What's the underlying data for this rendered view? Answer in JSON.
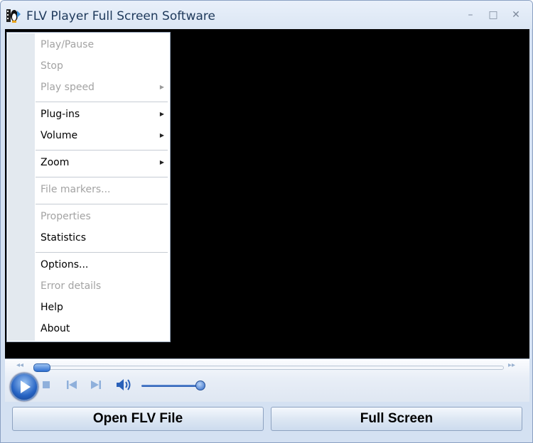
{
  "window": {
    "title": "FLV Player Full Screen Software"
  },
  "colors": {
    "title_text": "#1e395b",
    "video_bg": "#000000",
    "disabled_text": "#a3a3a3",
    "accent": "#2663c3"
  },
  "icons": {
    "app": "film-tux-icon",
    "minimize": "minimize-icon",
    "maximize": "maximize-icon",
    "close": "close-icon",
    "play": "play-icon",
    "stop": "stop-icon",
    "prev": "skip-back-icon",
    "next": "skip-forward-icon",
    "volume": "speaker-icon",
    "submenu": "triangle-right-icon"
  },
  "window_controls": {
    "minimize": "–",
    "maximize": "□",
    "close": "✕"
  },
  "seek": {
    "rewind_glyph": "◂◂",
    "forward_glyph": "▸▸",
    "position_fraction": 0.0
  },
  "volume": {
    "level_fraction": 1.0
  },
  "buttons": {
    "open": "Open FLV File",
    "fullscreen": "Full Screen"
  },
  "menu": {
    "items": [
      {
        "label": "Play/Pause",
        "enabled": false,
        "submenu": false
      },
      {
        "label": "Stop",
        "enabled": false,
        "submenu": false
      },
      {
        "label": "Play speed",
        "enabled": false,
        "submenu": true
      },
      {
        "label": "Plug-ins",
        "enabled": true,
        "submenu": true
      },
      {
        "label": "Volume",
        "enabled": true,
        "submenu": true
      },
      {
        "label": "Zoom",
        "enabled": true,
        "submenu": true
      },
      {
        "label": "File markers...",
        "enabled": false,
        "submenu": false
      },
      {
        "label": "Properties",
        "enabled": false,
        "submenu": false
      },
      {
        "label": "Statistics",
        "enabled": true,
        "submenu": false
      },
      {
        "label": "Options...",
        "enabled": true,
        "submenu": false
      },
      {
        "label": "Error details",
        "enabled": false,
        "submenu": false
      },
      {
        "label": "Help",
        "enabled": true,
        "submenu": false
      },
      {
        "label": "About",
        "enabled": true,
        "submenu": false
      }
    ]
  }
}
